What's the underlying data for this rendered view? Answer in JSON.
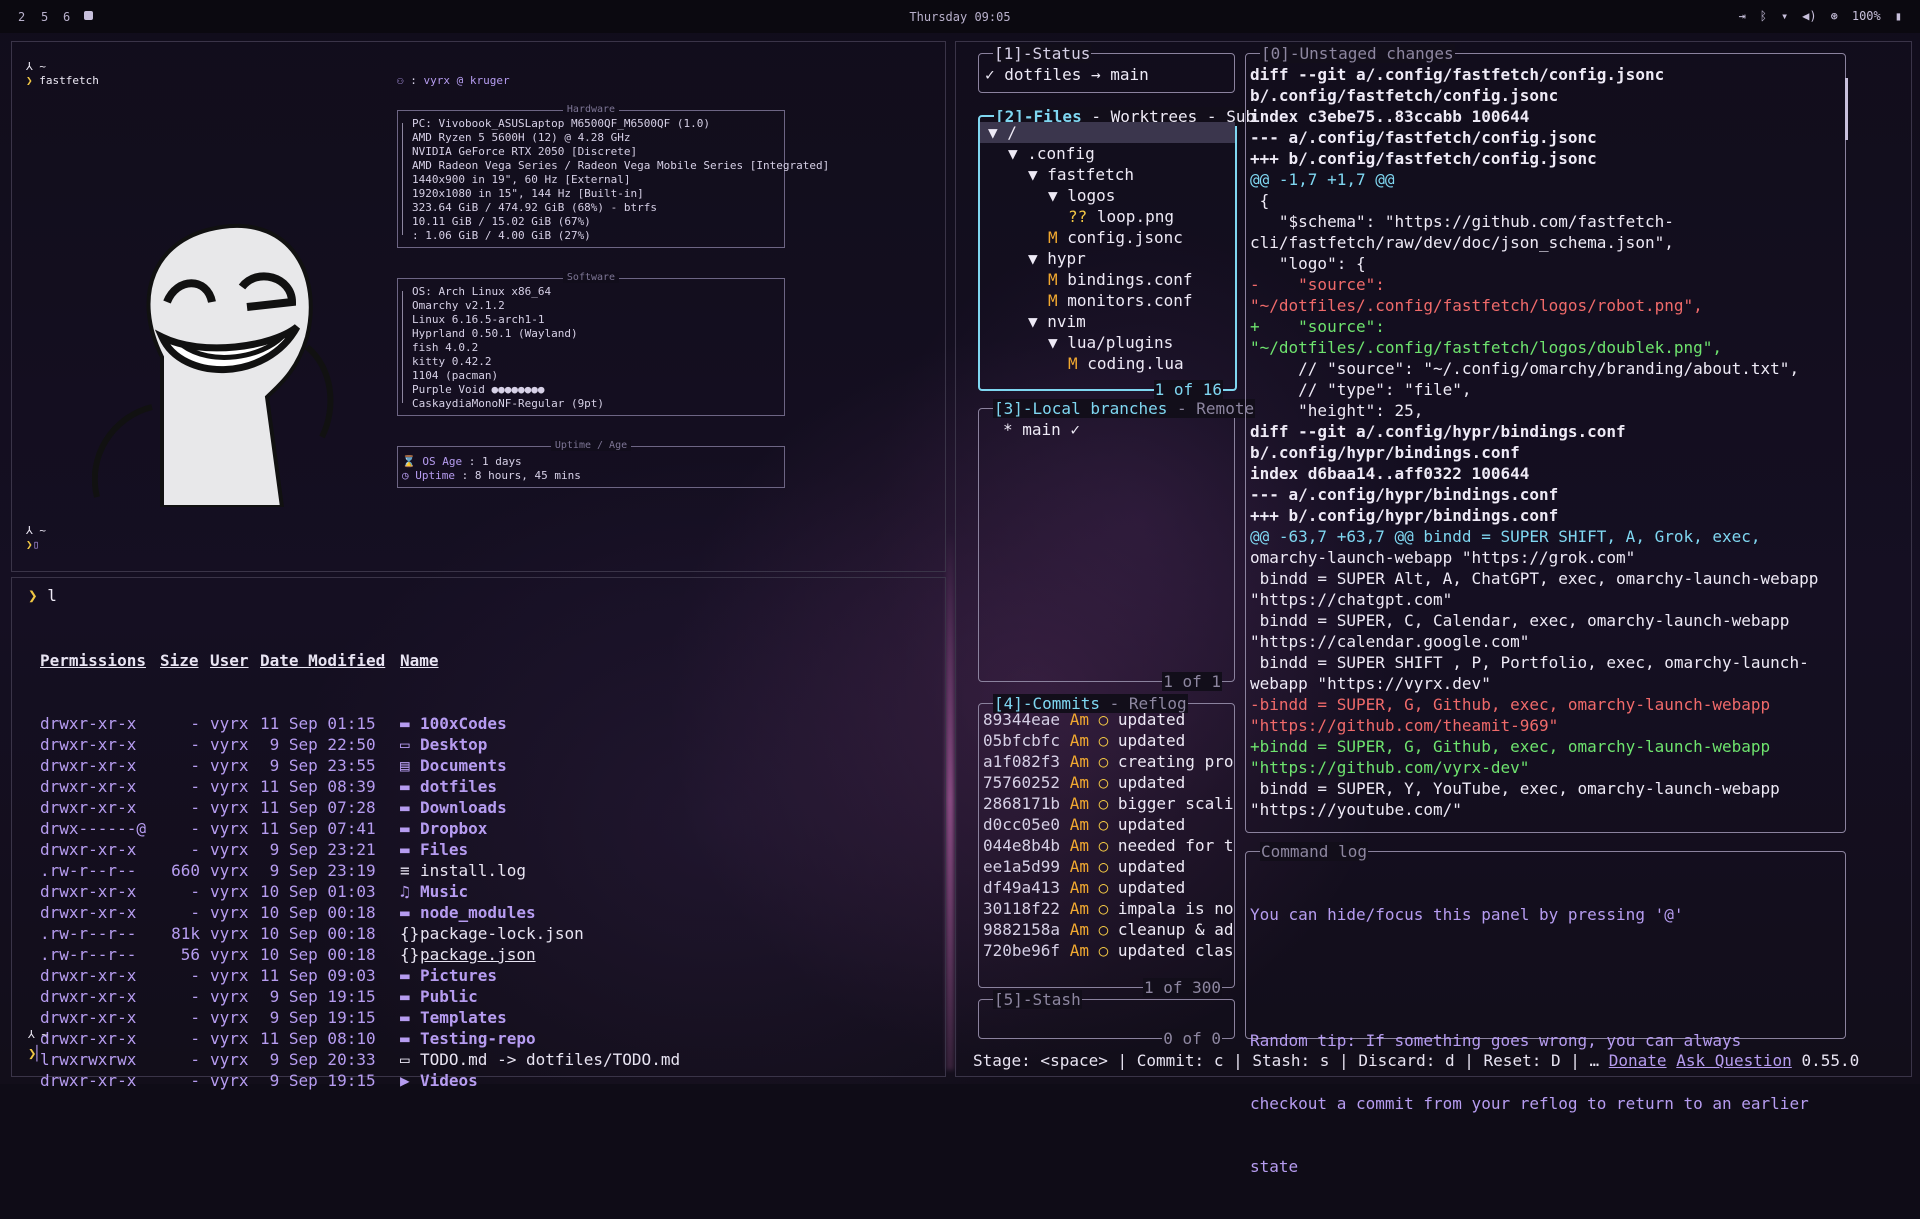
{
  "topbar": {
    "workspaces": [
      "2",
      "5",
      "6"
    ],
    "clock": "Thursday 09:05",
    "battery": "100%"
  },
  "fastfetch": {
    "prompt_home": "~",
    "command": "fastfetch",
    "user_line": "vyrx @ kruger",
    "hardware_title": "Hardware",
    "hardware": [
      "PC: Vivobook_ASUSLaptop M6500QF_M6500QF (1.0)",
      "AMD Ryzen 5 5600H (12) @ 4.28 GHz",
      "NVIDIA GeForce RTX 2050 [Discrete]",
      "AMD Radeon Vega Series / Radeon Vega Mobile Series [Integrated]",
      "1440x900 in 19\", 60 Hz [External]",
      "1920x1080 in 15\", 144 Hz [Built-in]",
      "323.64 GiB / 474.92 GiB (68%) - btrfs",
      "10.11 GiB / 15.02 GiB (67%)",
      ": 1.06 GiB / 4.00 GiB (27%)"
    ],
    "software_title": "Software",
    "software": [
      "OS: Arch Linux x86_64",
      "Omarchy v2.1.2",
      "Linux 6.16.5-arch1-1",
      "Hyprland 0.50.1 (Wayland)",
      "fish 4.0.2",
      "kitty 0.42.2",
      "1104 (pacman)",
      "Purple Void ●●●●●●●●",
      "CaskaydiaMonoNF-Regular (9pt)"
    ],
    "uptime_title": "Uptime / Age",
    "os_age_label": "OS Age",
    "os_age": ": 1 days",
    "uptime_label": "Uptime",
    "uptime": ": 8 hours, 45 mins",
    "prompt_home2": "~"
  },
  "ls": {
    "command": "l",
    "headers": [
      "Permissions",
      "Size",
      "User",
      "Date Modified",
      "Name"
    ],
    "rows": [
      {
        "perm": "drwxr-xr-x",
        "size": "-",
        "user": "vyrx",
        "date": "11 Sep 01:15",
        "name": "100xCodes",
        "dir": true
      },
      {
        "perm": "drwxr-xr-x",
        "size": "-",
        "user": "vyrx",
        "date": " 9 Sep 22:50",
        "name": "Desktop",
        "dir": true
      },
      {
        "perm": "drwxr-xr-x",
        "size": "-",
        "user": "vyrx",
        "date": " 9 Sep 23:55",
        "name": "Documents",
        "dir": true
      },
      {
        "perm": "drwxr-xr-x",
        "size": "-",
        "user": "vyrx",
        "date": "11 Sep 08:39",
        "name": "dotfiles",
        "dir": true
      },
      {
        "perm": "drwxr-xr-x",
        "size": "-",
        "user": "vyrx",
        "date": "11 Sep 07:28",
        "name": "Downloads",
        "dir": true
      },
      {
        "perm": "drwx------@",
        "size": "-",
        "user": "vyrx",
        "date": "11 Sep 07:41",
        "name": "Dropbox",
        "dir": true
      },
      {
        "perm": "drwxr-xr-x",
        "size": "-",
        "user": "vyrx",
        "date": " 9 Sep 23:21",
        "name": "Files",
        "dir": true
      },
      {
        "perm": ".rw-r--r--",
        "size": "660",
        "user": "vyrx",
        "date": " 9 Sep 23:19",
        "name": "install.log",
        "dir": false
      },
      {
        "perm": "drwxr-xr-x",
        "size": "-",
        "user": "vyrx",
        "date": "10 Sep 01:03",
        "name": "Music",
        "dir": true
      },
      {
        "perm": "drwxr-xr-x",
        "size": "-",
        "user": "vyrx",
        "date": "10 Sep 00:18",
        "name": "node_modules",
        "dir": true
      },
      {
        "perm": ".rw-r--r--",
        "size": "81k",
        "user": "vyrx",
        "date": "10 Sep 00:18",
        "name": "package-lock.json",
        "dir": false
      },
      {
        "perm": ".rw-r--r--",
        "size": "56",
        "user": "vyrx",
        "date": "10 Sep 00:18",
        "name": "package.json",
        "dir": false
      },
      {
        "perm": "drwxr-xr-x",
        "size": "-",
        "user": "vyrx",
        "date": "11 Sep 09:03",
        "name": "Pictures",
        "dir": true
      },
      {
        "perm": "drwxr-xr-x",
        "size": "-",
        "user": "vyrx",
        "date": " 9 Sep 19:15",
        "name": "Public",
        "dir": true
      },
      {
        "perm": "drwxr-xr-x",
        "size": "-",
        "user": "vyrx",
        "date": " 9 Sep 19:15",
        "name": "Templates",
        "dir": true
      },
      {
        "perm": "drwxr-xr-x",
        "size": "-",
        "user": "vyrx",
        "date": "11 Sep 08:10",
        "name": "Testing-repo",
        "dir": true
      },
      {
        "perm": "lrwxrwxrwx",
        "size": "-",
        "user": "vyrx",
        "date": " 9 Sep 20:33",
        "name": "TODO.md -> dotfiles/TODO.md",
        "dir": false
      },
      {
        "perm": "drwxr-xr-x",
        "size": "-",
        "user": "vyrx",
        "date": " 9 Sep 19:15",
        "name": "Videos",
        "dir": true
      }
    ],
    "prompt_home": "~"
  },
  "lazygit": {
    "status_title": "[1]-Status",
    "status_line": "✓ dotfiles → main",
    "files_title": "[2]-Files",
    "files_tabs": " - Worktrees - Sub",
    "files_counter": "1 of 16",
    "files": [
      {
        "indent": 0,
        "prefix": "▼",
        "status": "",
        "name": "/"
      },
      {
        "indent": 1,
        "prefix": "▼",
        "status": "",
        "name": ".config"
      },
      {
        "indent": 2,
        "prefix": "▼",
        "status": "",
        "name": "fastfetch"
      },
      {
        "indent": 3,
        "prefix": "▼",
        "status": "",
        "name": "logos"
      },
      {
        "indent": 4,
        "prefix": "",
        "status": "??",
        "name": "loop.png"
      },
      {
        "indent": 3,
        "prefix": "",
        "status": "M",
        "name": "config.jsonc"
      },
      {
        "indent": 2,
        "prefix": "▼",
        "status": "",
        "name": "hypr"
      },
      {
        "indent": 3,
        "prefix": "",
        "status": "M",
        "name": "bindings.conf"
      },
      {
        "indent": 3,
        "prefix": "",
        "status": "M",
        "name": "monitors.conf"
      },
      {
        "indent": 2,
        "prefix": "▼",
        "status": "",
        "name": "nvim"
      },
      {
        "indent": 3,
        "prefix": "▼",
        "status": "",
        "name": "lua/plugins"
      },
      {
        "indent": 4,
        "prefix": "",
        "status": "M",
        "name": "coding.lua"
      }
    ],
    "branches_title": "[3]-Local branches",
    "branches_tabs": " - Remote",
    "branches": [
      "* main ✓"
    ],
    "branches_counter": "1 of 1",
    "commits_title": "[4]-Commits",
    "commits_tabs": " - Reflog",
    "commits_counter": "1 of 300",
    "commits": [
      {
        "hash": "89344eae",
        "author": "Am",
        "msg": "updated"
      },
      {
        "hash": "05bfcbfc",
        "author": "Am",
        "msg": "updated"
      },
      {
        "hash": "a1f082f3",
        "author": "Am",
        "msg": "creating proble"
      },
      {
        "hash": "75760252",
        "author": "Am",
        "msg": "updated"
      },
      {
        "hash": "2868171b",
        "author": "Am",
        "msg": "bigger scaling"
      },
      {
        "hash": "d0cc05e0",
        "author": "Am",
        "msg": "updated"
      },
      {
        "hash": "044e8b4b",
        "author": "Am",
        "msg": "needed for time"
      },
      {
        "hash": "ee1a5d99",
        "author": "Am",
        "msg": "updated"
      },
      {
        "hash": "df49a413",
        "author": "Am",
        "msg": "updated"
      },
      {
        "hash": "30118f22",
        "author": "Am",
        "msg": "impala is not w"
      },
      {
        "hash": "9882158a",
        "author": "Am",
        "msg": "cleanup & added"
      },
      {
        "hash": "720be96f",
        "author": "Am",
        "msg": "updated class o"
      }
    ],
    "stash_title": "[5]-Stash",
    "stash_counter": "0 of 0",
    "diff_title": "[0]-Unstaged changes",
    "diff_lines": [
      {
        "t": "diff --git a/.config/fastfetch/config.jsonc",
        "k": "hdr"
      },
      {
        "t": "b/.config/fastfetch/config.jsonc",
        "k": "hdr"
      },
      {
        "t": "index c3ebe75..83ccabb 100644",
        "k": "hdr"
      },
      {
        "t": "--- a/.config/fastfetch/config.jsonc",
        "k": "hdr"
      },
      {
        "t": "+++ b/.config/fastfetch/config.jsonc",
        "k": "hdr"
      },
      {
        "t": "@@ -1,7 +1,7 @@",
        "k": "hunk"
      },
      {
        "t": " {",
        "k": "ctx"
      },
      {
        "t": "   \"$schema\": \"https://github.com/fastfetch-",
        "k": "ctx"
      },
      {
        "t": "cli/fastfetch/raw/dev/doc/json_schema.json\",",
        "k": "ctx"
      },
      {
        "t": "   \"logo\": {",
        "k": "ctx"
      },
      {
        "t": "-    \"source\":",
        "k": "del"
      },
      {
        "t": "\"~/dotfiles/.config/fastfetch/logos/robot.png\",",
        "k": "del"
      },
      {
        "t": "+    \"source\":",
        "k": "add"
      },
      {
        "t": "\"~/dotfiles/.config/fastfetch/logos/doublek.png\",",
        "k": "add"
      },
      {
        "t": "     // \"source\": \"~/.config/omarchy/branding/about.txt\",",
        "k": "ctx"
      },
      {
        "t": "     // \"type\": \"file\",",
        "k": "ctx"
      },
      {
        "t": "     \"height\": 25,",
        "k": "ctx"
      },
      {
        "t": "diff --git a/.config/hypr/bindings.conf",
        "k": "hdr"
      },
      {
        "t": "b/.config/hypr/bindings.conf",
        "k": "hdr"
      },
      {
        "t": "index d6baa14..aff0322 100644",
        "k": "hdr"
      },
      {
        "t": "--- a/.config/hypr/bindings.conf",
        "k": "hdr"
      },
      {
        "t": "+++ b/.config/hypr/bindings.conf",
        "k": "hdr"
      },
      {
        "t": "@@ -63,7 +63,7 @@ bindd = SUPER SHIFT, A, Grok, exec,",
        "k": "hunk"
      },
      {
        "t": "omarchy-launch-webapp \"https://grok.com\"",
        "k": "ctx"
      },
      {
        "t": " bindd = SUPER Alt, A, ChatGPT, exec, omarchy-launch-webapp",
        "k": "ctx"
      },
      {
        "t": "\"https://chatgpt.com\"",
        "k": "ctx"
      },
      {
        "t": " bindd = SUPER, C, Calendar, exec, omarchy-launch-webapp",
        "k": "ctx"
      },
      {
        "t": "\"https://calendar.google.com\"",
        "k": "ctx"
      },
      {
        "t": " bindd = SUPER SHIFT , P, Portfolio, exec, omarchy-launch-",
        "k": "ctx"
      },
      {
        "t": "webapp \"https://vyrx.dev\"",
        "k": "ctx"
      },
      {
        "t": "-bindd = SUPER, G, Github, exec, omarchy-launch-webapp",
        "k": "del"
      },
      {
        "t": "\"https://github.com/theamit-969\"",
        "k": "del"
      },
      {
        "t": "+bindd = SUPER, G, Github, exec, omarchy-launch-webapp",
        "k": "add"
      },
      {
        "t": "\"https://github.com/vyrx-dev\"",
        "k": "add"
      },
      {
        "t": " bindd = SUPER, Y, YouTube, exec, omarchy-launch-webapp",
        "k": "ctx"
      },
      {
        "t": "\"https://youtube.com/\"",
        "k": "ctx"
      }
    ],
    "cmdlog_title": "Command log",
    "cmdlog_lines": [
      "You can hide/focus this panel by pressing '@'",
      "",
      "Random tip: If something goes wrong, you can always",
      "checkout a commit from your reflog to return to an earlier",
      "state"
    ],
    "bottom_keys": "Stage: <space> | Commit: c | Stash: s | Discard: d | Reset: D | … ",
    "donate": "Donate",
    "ask": "Ask Question",
    "version": "0.55.0"
  }
}
